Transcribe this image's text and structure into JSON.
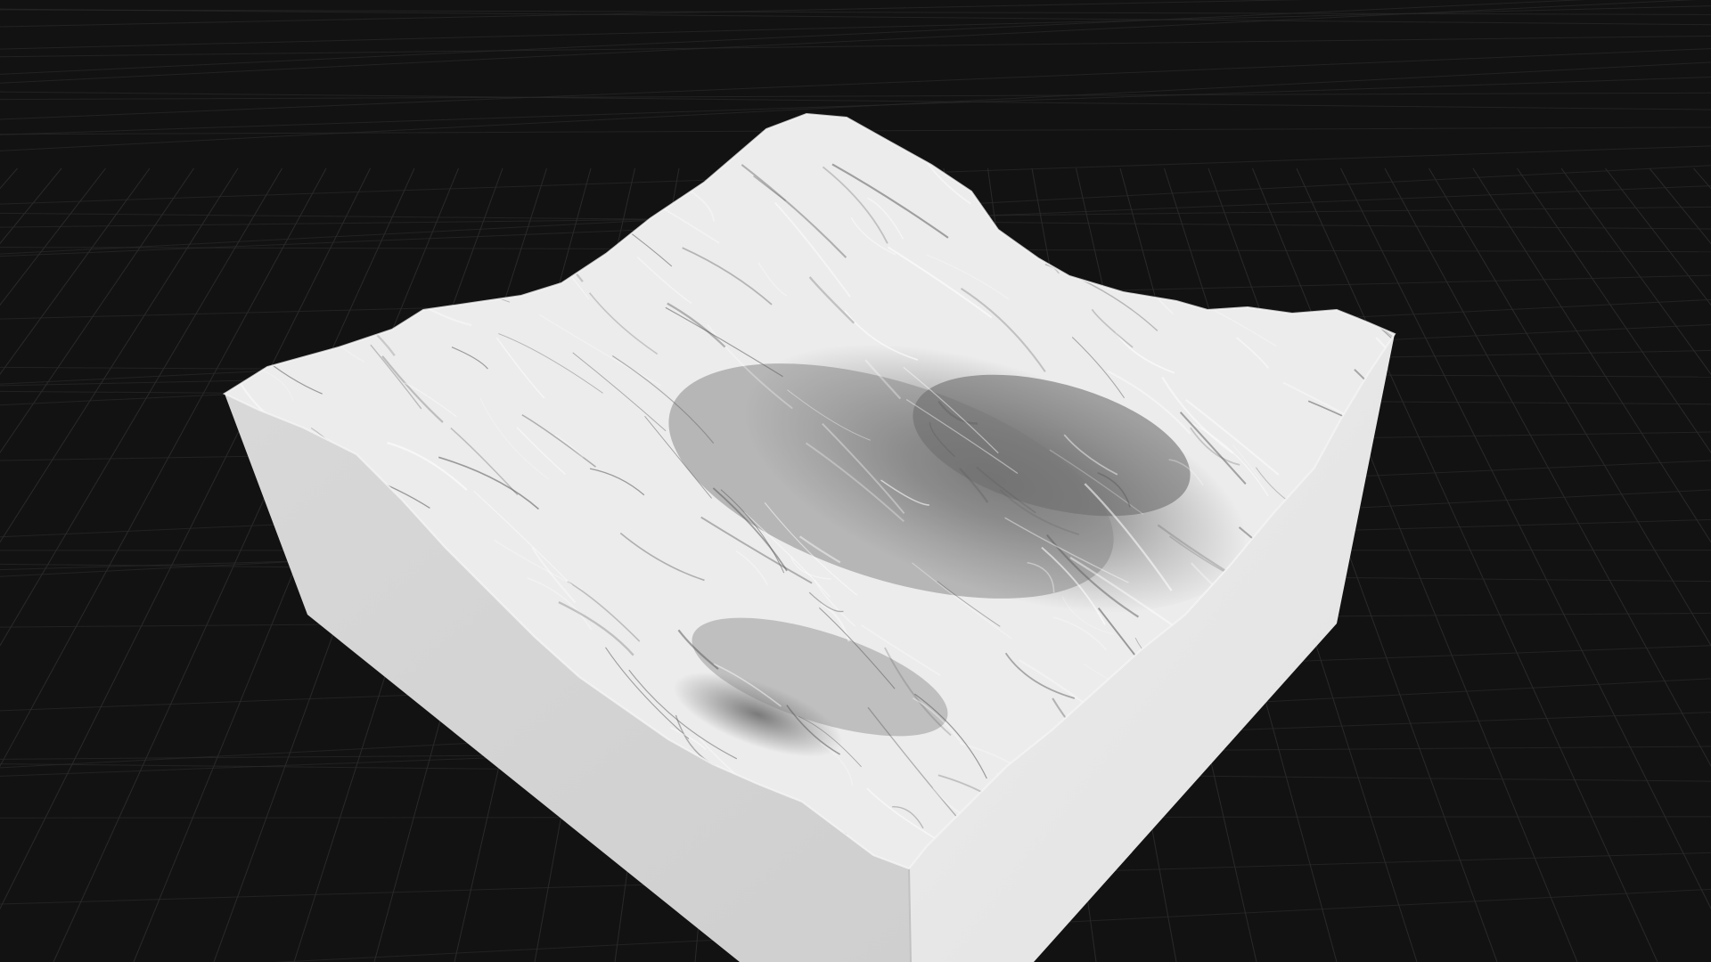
{
  "viewport": {
    "background_color": "#121212",
    "grid_color": "#2a2a2a",
    "terrain_light_color": "#f0f0f0",
    "terrain_mid_color": "#b8b8b8",
    "terrain_dark_color": "#6a6a6a",
    "block_side_left_color": "#d4d4d4",
    "block_side_right_color": "#e8e8e8"
  }
}
